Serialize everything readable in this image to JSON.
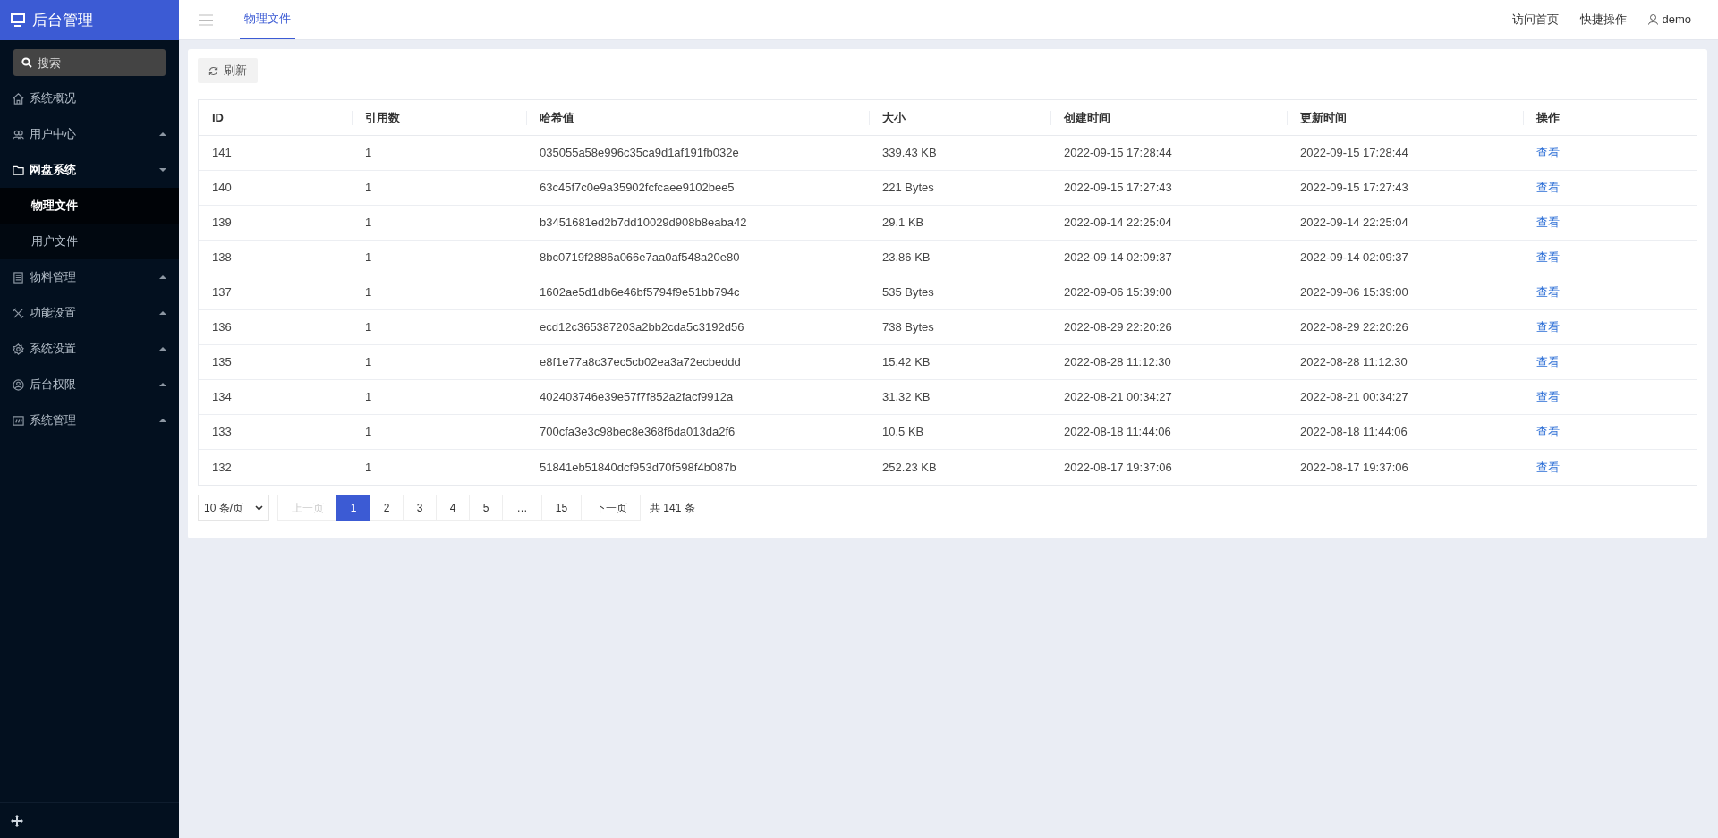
{
  "brand": {
    "title": "后台管理"
  },
  "sidebar": {
    "search": {
      "placeholder": "搜索"
    },
    "items": [
      {
        "label": "系统概况",
        "selected": false
      },
      {
        "label": "用户中心",
        "expanded": false,
        "selected": false
      },
      {
        "label": "网盘系统",
        "expanded": true,
        "selected": true,
        "children": [
          {
            "label": "物理文件",
            "selected": true
          },
          {
            "label": "用户文件",
            "selected": false
          }
        ]
      },
      {
        "label": "物料管理",
        "expanded": false,
        "selected": false
      },
      {
        "label": "功能设置",
        "expanded": false,
        "selected": false
      },
      {
        "label": "系统设置",
        "expanded": false,
        "selected": false
      },
      {
        "label": "后台权限",
        "expanded": false,
        "selected": false
      },
      {
        "label": "系统管理",
        "expanded": false,
        "selected": false
      }
    ]
  },
  "topbar": {
    "tabs": [
      {
        "label": "物理文件",
        "selected": true
      }
    ],
    "links": [
      "访问首页",
      "快捷操作"
    ],
    "user": "demo"
  },
  "toolbar": {
    "refresh": "刷新"
  },
  "table": {
    "columns": [
      "ID",
      "引用数",
      "哈希值",
      "大小",
      "创建时间",
      "更新时间",
      "操作"
    ],
    "rows": [
      [
        "141",
        "1",
        "035055a58e996c35ca9d1af191fb032e",
        "339.43 KB",
        "2022-09-15 17:28:44",
        "2022-09-15 17:28:44",
        "查看"
      ],
      [
        "140",
        "1",
        "63c45f7c0e9a35902fcfcaee9102bee5",
        "221 Bytes",
        "2022-09-15 17:27:43",
        "2022-09-15 17:27:43",
        "查看"
      ],
      [
        "139",
        "1",
        "b3451681ed2b7dd10029d908b8eaba42",
        "29.1 KB",
        "2022-09-14 22:25:04",
        "2022-09-14 22:25:04",
        "查看"
      ],
      [
        "138",
        "1",
        "8bc0719f2886a066e7aa0af548a20e80",
        "23.86 KB",
        "2022-09-14 02:09:37",
        "2022-09-14 02:09:37",
        "查看"
      ],
      [
        "137",
        "1",
        "1602ae5d1db6e46bf5794f9e51bb794c",
        "535 Bytes",
        "2022-09-06 15:39:00",
        "2022-09-06 15:39:00",
        "查看"
      ],
      [
        "136",
        "1",
        "ecd12c365387203a2bb2cda5c3192d56",
        "738 Bytes",
        "2022-08-29 22:20:26",
        "2022-08-29 22:20:26",
        "查看"
      ],
      [
        "135",
        "1",
        "e8f1e77a8c37ec5cb02ea3a72ecbeddd",
        "15.42 KB",
        "2022-08-28 11:12:30",
        "2022-08-28 11:12:30",
        "查看"
      ],
      [
        "134",
        "1",
        "402403746e39e57f7f852a2facf9912a",
        "31.32 KB",
        "2022-08-21 00:34:27",
        "2022-08-21 00:34:27",
        "查看"
      ],
      [
        "133",
        "1",
        "700cfa3e3c98bec8e368f6da013da2f6",
        "10.5 KB",
        "2022-08-18 11:44:06",
        "2022-08-18 11:44:06",
        "查看"
      ],
      [
        "132",
        "1",
        "51841eb51840dcf953d70f598f4b087b",
        "252.23 KB",
        "2022-08-17 19:37:06",
        "2022-08-17 19:37:06",
        "查看"
      ]
    ]
  },
  "pagination": {
    "page_size": "10 条/页",
    "prev": {
      "label": "上一页",
      "disabled": true
    },
    "pages": [
      {
        "label": "1",
        "selected": true
      },
      {
        "label": "2",
        "selected": false
      },
      {
        "label": "3",
        "selected": false
      },
      {
        "label": "4",
        "selected": false
      },
      {
        "label": "5",
        "selected": false
      },
      {
        "label": "…",
        "selected": false
      },
      {
        "label": "15",
        "selected": false
      }
    ],
    "next": {
      "label": "下一页",
      "disabled": false
    },
    "total": "共 141 条"
  }
}
